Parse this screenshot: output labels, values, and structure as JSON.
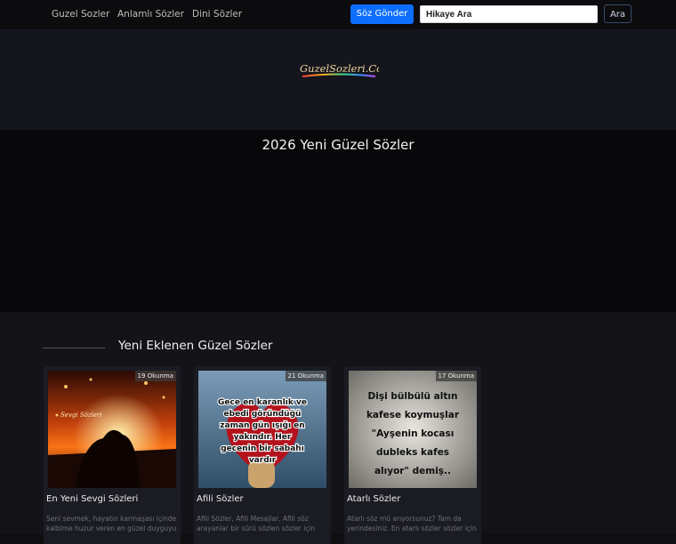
{
  "nav": {
    "links": [
      "Guzel Sozler",
      "Anlamlı Sözler",
      "Dini Sözler"
    ],
    "submit_label": "Söz Gönder",
    "search_placeholder": "Hikaye Ara",
    "search_button": "Ara"
  },
  "hero": {
    "logo_text": "GuzelSozleri.Com"
  },
  "page": {
    "title": "2026 Yeni Güzel Sözler"
  },
  "section": {
    "heading": "Yeni Eklenen Güzel Sözler"
  },
  "cards": [
    {
      "badge": "19 Okunma",
      "title": "En Yeni Sevgi Sözleri",
      "description": "Seni sevmek, hayatın karmaşası içinde kalbime huzur veren en güzel duyguyu",
      "image_text": "Sevgi Sözleri"
    },
    {
      "badge": "21 Okunma",
      "title": "Afili Sözler",
      "description": "Afili Sözler, Afili Mesajlar, Afili söz arayanlar bir sürü sözlen sözler için",
      "image_lines": [
        "Gece en karanlık ve",
        "ebedi göründüğü",
        "zaman gün ışığı en",
        "yakındır. Her",
        "gecenin bir sabahı",
        "vardır"
      ]
    },
    {
      "badge": "17 Okunma",
      "title": "Atarlı Sözler",
      "description": "Atarlı söz mü arıyorsunuz? Tam da yerindesiniz. En atarlı sözler sözler için",
      "image_lines": [
        "Dişi bülbülü altın",
        "kafese koymuşlar",
        "\"Ayşenin kocası",
        "dubleks kafes",
        "alıyor\" demiş.."
      ]
    }
  ]
}
